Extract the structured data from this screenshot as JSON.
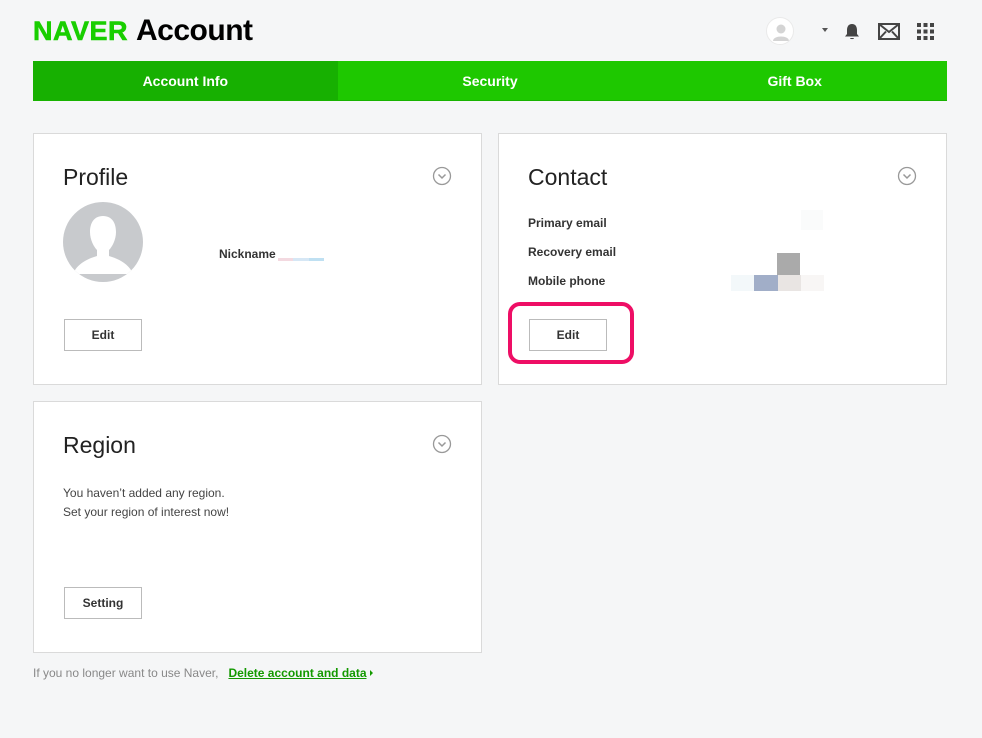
{
  "header": {
    "logo_brand": "NAVER",
    "logo_product": "Account",
    "icons": [
      "user-avatar-icon",
      "caret-down-icon",
      "bell-icon",
      "mail-icon",
      "apps-grid-icon"
    ]
  },
  "tabs": [
    {
      "label": "Account Info",
      "active": true
    },
    {
      "label": "Security",
      "active": false
    },
    {
      "label": "Gift Box",
      "active": false
    }
  ],
  "profile": {
    "title": "Profile",
    "nickname_label": "Nickname",
    "edit_label": "Edit"
  },
  "contact": {
    "title": "Contact",
    "primary_email_label": "Primary email",
    "recovery_email_label": "Recovery email",
    "mobile_phone_label": "Mobile phone",
    "edit_label": "Edit"
  },
  "region": {
    "title": "Region",
    "message_line1": "You haven’t added any region.",
    "message_line2": "Set your region of interest now!",
    "setting_label": "Setting"
  },
  "footer": {
    "text": "If you no longer want to use Naver,",
    "link_label": "Delete account and data"
  },
  "colors": {
    "brand_green": "#1ec800",
    "active_tab": "#17b001",
    "highlight": "#ee0e65"
  }
}
